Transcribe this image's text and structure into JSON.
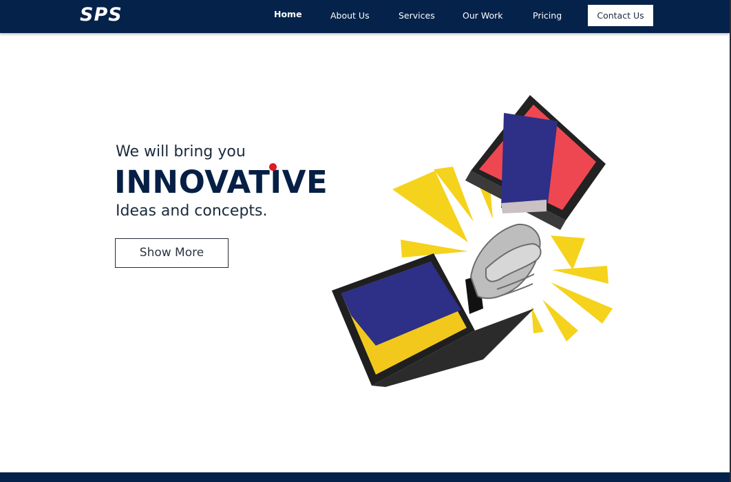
{
  "navbar": {
    "logo": "SPS",
    "links": [
      {
        "label": "Home",
        "active": true
      },
      {
        "label": "About Us",
        "active": false
      },
      {
        "label": "Services",
        "active": false
      },
      {
        "label": "Our Work",
        "active": false
      },
      {
        "label": "Pricing",
        "active": false
      }
    ],
    "contact_label": "Contact Us"
  },
  "hero": {
    "line1": "We will bring you",
    "title": "INNOVATIVE",
    "line3": "Ideas and concepts.",
    "button_label": "Show More"
  },
  "colors": {
    "navy": "#05224a",
    "accent_red": "#e11b22",
    "burst_yellow": "#f5d21c",
    "sleeve_blue": "#2e2f86",
    "screen_red": "#ef4752"
  }
}
